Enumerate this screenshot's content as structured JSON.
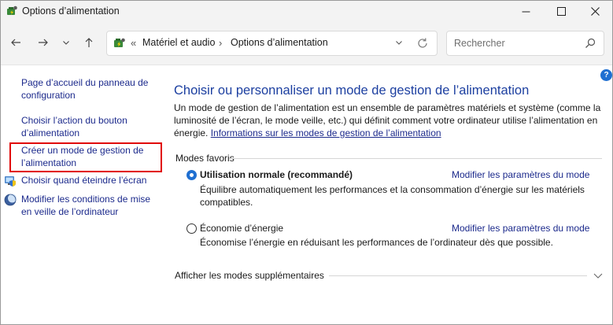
{
  "window": {
    "title": "Options d’alimentation"
  },
  "address": {
    "breadcrumbs": [
      "Matériel et audio",
      "Options d’alimentation"
    ],
    "root_sep": "«",
    "sep": "›"
  },
  "search": {
    "placeholder": "Rechercher"
  },
  "sidebar": {
    "items": [
      {
        "label": "Page d’accueil du panneau de configuration"
      },
      {
        "label": "Choisir l’action du bouton d’alimentation"
      },
      {
        "label": "Créer un mode de gestion de l’alimentation"
      },
      {
        "label": "Choisir quand éteindre l’écran"
      },
      {
        "label": "Modifier les conditions de mise en veille de l’ordinateur"
      }
    ]
  },
  "main": {
    "help": "?",
    "title": "Choisir ou personnaliser un mode de gestion de l’alimentation",
    "description": "Un mode de gestion de l’alimentation est un ensemble de paramètres matériels et système (comme la luminosité de l’écran, le mode veille, etc.) qui définit comment votre ordinateur utilise l’alimentation en énergie.",
    "info_link": "Informations sur les modes de gestion de l’alimentation",
    "section_label": "Modes favoris",
    "plans": [
      {
        "name": "Utilisation normale (recommandé)",
        "selected": true,
        "link": "Modifier les paramètres du mode",
        "description": "Équilibre automatiquement les performances et la consommation d’énergie sur les matériels compatibles."
      },
      {
        "name": "Économie d’énergie",
        "selected": false,
        "link": "Modifier les paramètres du mode",
        "description": "Économise l’énergie en réduisant les performances de l’ordinateur dès que possible."
      }
    ],
    "more_label": "Afficher les modes supplémentaires"
  },
  "colors": {
    "link": "#1c2a8c",
    "title": "#1c3fa0",
    "accent": "#1f6fd1",
    "highlight": "#e10000"
  }
}
